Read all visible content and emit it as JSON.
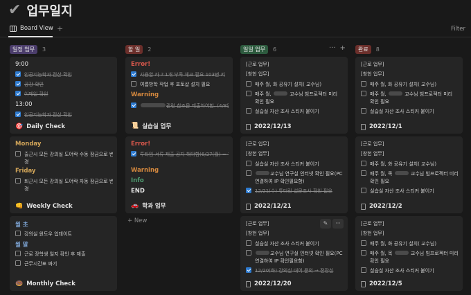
{
  "page": {
    "title": "업무일지",
    "icon": "check-icon"
  },
  "view": {
    "tab_label": "Board View",
    "add": "+",
    "filter": "Filter"
  },
  "columns": [
    {
      "label": "일정 업무",
      "count": "3",
      "color": "#4b3d6b"
    },
    {
      "label": "할 일",
      "count": "2",
      "color": "#6b2f2b"
    },
    {
      "label": "일일 업무",
      "count": "6",
      "color": "#2d5a3e"
    },
    {
      "label": "완료",
      "count": "8",
      "color": "#6b2f2b"
    }
  ],
  "col1": {
    "c1": {
      "t1": "9:00",
      "i1": "인공지능학과 전산 확인",
      "i2": "공강 확인",
      "i3": "이메일 확인",
      "t2": "13:00",
      "i4": "인공지능학과 전산 확인",
      "foot": "Daily Check"
    },
    "c2": {
      "h1": "Monday",
      "i1": "출근시 모든 강의실 도어락 수동 잠금으로 변경",
      "h2": "Friday",
      "i2": "퇴근시 모든 강의실 도어락 자동 잠금으로 변경",
      "foot": "Weekly Check"
    },
    "c3": {
      "h1": "월 초",
      "i1": "강의실 윈도우 업데이트",
      "h2": "월 말",
      "i2": "근로 장학생 일지 확인 후 제출",
      "i3": "근무시간표 짜기",
      "foot": "Monthly Check"
    }
  },
  "col2": {
    "c1": {
      "h1": "Error!",
      "i1": "사용할 카 ? 1개 부족 체크 필요 103번 키",
      "i2": "여름방학 작업 후 포토샵 설치 필요",
      "h2": "Warning",
      "i3": "관련 참조문 제출하여함. (4/8일까지) → 4월 초에 제출하는걸로 진행",
      "foot": "실습실 업무"
    },
    "c2": {
      "h1": "Error!",
      "i1": "투타임 서류 제출 공지 해야함(6/27(월) ~ 7/1(금))",
      "h2": "Warning",
      "h3": "Info",
      "h4": "END",
      "foot": "학과 업무"
    },
    "new": "+ New"
  },
  "col3": {
    "c1": {
      "h0": "[근로 업무]",
      "h1": "[창헌 업무]",
      "i1": "매주 월, 화 공유기 설치(     교수님)",
      "i2a": "매주 월,",
      "i2b": "교수님 빔프로젝터 미리",
      "i2c": "확인 필요",
      "i3": "실습실 자산 조사 스티커 붙이기",
      "foot": "2022/12/13"
    },
    "c2": {
      "h0": "[근로 업무]",
      "h1": "[창헌 업무]",
      "i1": "실습실 자산 조사 스티커 붙이기",
      "i2a": "교수님 연구실 인터넷 확인 필요(PC",
      "i2b": "연결하여 IP 확인필요함)",
      "i3": "12/21(수) 튜터링 설문조사 확인 필요",
      "foot": "2022/12/21"
    },
    "c3": {
      "h0": "[근로 업무]",
      "h1": "[창헌 업무]",
      "i1": "실습실 자산 조사 스티커 붙이기",
      "i2a": "교수님 연구실 인터넷 확인 필요(PC",
      "i2b": "연결하여 IP 확인필요함)",
      "i3": "12/20(화)    강의실 대여 문의 → 전장실",
      "foot": "2022/12/20"
    }
  },
  "col4": {
    "c1": {
      "h0": "[근로 업무]",
      "h1": "[창헌 업무]",
      "i1": "매주 월, 화 공유기 설치(     교수님)",
      "i2a": "매주 월,",
      "i2b": "교수님 빔프로젝터 미리",
      "i2c": "확인 필요",
      "i3": "실습실 자산 조사 스티커 붙이기",
      "foot": "2022/12/1"
    },
    "c2": {
      "h0": "[근로 업무]",
      "h1": "[창헌 업무]",
      "i1": "매주 월, 화 공유기 설치(     교수님)",
      "i2a": "매주 월, 목",
      "i2b": "교수님 빔프로젝터 미리",
      "i2c": "확인 필요",
      "i3": "실습실 자산 조사 스티커 붙이기",
      "foot": "2022/12/2"
    },
    "c3": {
      "h0": "[근로 업무]",
      "h1": "[창헌 업무]",
      "i1": "매주 월, 화 공유기 설치(     교수님)",
      "i2a": "매주 월, 목",
      "i2b": "교수님 빔프로젝터 미리",
      "i2c": "확인 필요",
      "i3": "실습실 자산 조사 스티커 붙이기",
      "foot": "2022/12/5"
    }
  }
}
